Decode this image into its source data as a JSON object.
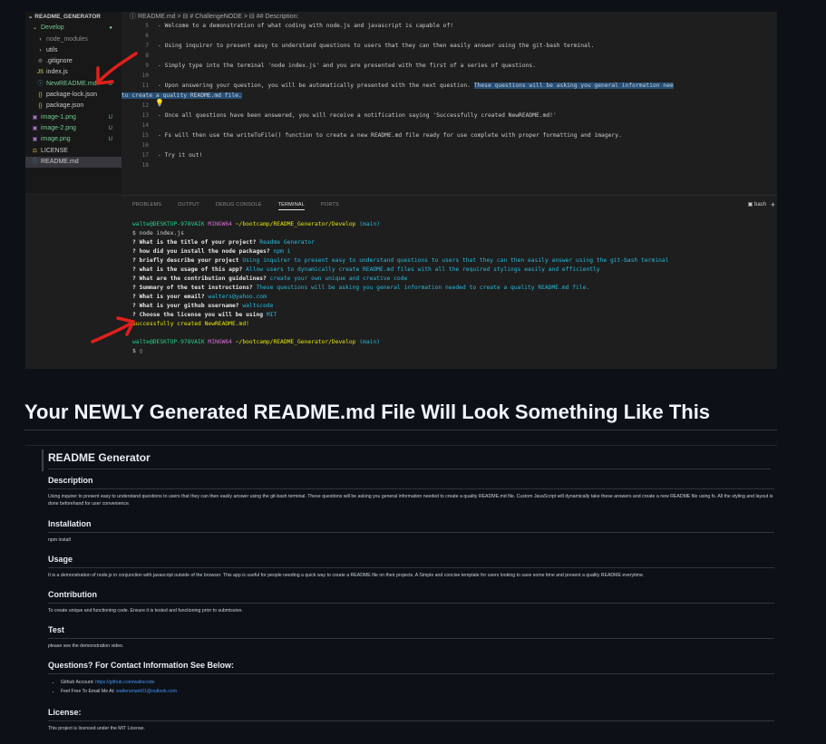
{
  "vscode": {
    "explorer": {
      "root_label": "README_GENERATOR",
      "items": [
        {
          "icon": "chevron-down",
          "label": "Develop",
          "badge": "●",
          "cls": "folder",
          "indent": 6
        },
        {
          "icon": "chevron-right",
          "label": "node_modules",
          "badge": "",
          "cls": "gray",
          "indent": 12
        },
        {
          "icon": "chevron-right",
          "label": "utils",
          "badge": "",
          "cls": "",
          "indent": 12
        },
        {
          "icon": "gear",
          "label": ".gitignore",
          "badge": "",
          "cls": "",
          "indent": 12
        },
        {
          "icon": "js",
          "label": "index.js",
          "badge": "",
          "cls": "",
          "indent": 12
        },
        {
          "icon": "info",
          "label": "NewREADME.md",
          "badge": "U",
          "cls": "mod",
          "indent": 12
        },
        {
          "icon": "braces",
          "label": "package-lock.json",
          "badge": "",
          "cls": "",
          "indent": 12
        },
        {
          "icon": "braces",
          "label": "package.json",
          "badge": "",
          "cls": "",
          "indent": 12
        },
        {
          "icon": "image",
          "label": "image-1.png",
          "badge": "U",
          "cls": "mod",
          "indent": 6
        },
        {
          "icon": "image",
          "label": "image-2.png",
          "badge": "U",
          "cls": "mod",
          "indent": 6
        },
        {
          "icon": "image",
          "label": "image.png",
          "badge": "U",
          "cls": "mod",
          "indent": 6
        },
        {
          "icon": "license",
          "label": "LICENSE",
          "badge": "",
          "cls": "",
          "indent": 6
        },
        {
          "icon": "info",
          "label": "README.md",
          "badge": "",
          "cls": "sel",
          "indent": 6
        }
      ]
    },
    "breadcrumb": "ⓘ README.md > ⊟ # ChallengeNODE > ⊟ ## Description:",
    "editor_lines": [
      {
        "n": "5",
        "text": "- Welcome to a demonstration of what coding with node.js and javascript is capable of!",
        "hl": ""
      },
      {
        "n": "6",
        "text": "",
        "hl": ""
      },
      {
        "n": "7",
        "text": "- Using inquirer to present easy to understand questions to users that they can then easily answer using the git-bash terminal.",
        "hl": ""
      },
      {
        "n": "8",
        "text": "",
        "hl": ""
      },
      {
        "n": "9",
        "text": "- Simply type into the terminal 'node index.js' and you are presented with the first of a series of questions.",
        "hl": ""
      },
      {
        "n": "10",
        "text": "",
        "hl": ""
      },
      {
        "n": "11",
        "text": "- Upon answering your question, you will be automatically presented with the next question. ",
        "hl": "These questions will be asking you general information nee"
      },
      {
        "n": "",
        "text": "",
        "hl": "to create a quality README.md file."
      },
      {
        "n": "12",
        "text": "",
        "hl": ""
      },
      {
        "n": "13",
        "text": "- Once all questions have been answered, you will receive a notification saying 'Successfully created NewREADME.md!'",
        "hl": ""
      },
      {
        "n": "14",
        "text": "",
        "hl": ""
      },
      {
        "n": "15",
        "text": "- Fs will then use the writeToFile() function to create a new README.md file ready for use complete with proper formatting and imagery.",
        "hl": ""
      },
      {
        "n": "16",
        "text": "",
        "hl": ""
      },
      {
        "n": "17",
        "text": "- Try it out!",
        "hl": ""
      },
      {
        "n": "18",
        "text": "",
        "hl": ""
      }
    ],
    "panel_tabs": [
      "PROBLEMS",
      "OUTPUT",
      "DEBUG CONSOLE",
      "TERMINAL",
      "PORTS"
    ],
    "panel_shell": "bash",
    "terminal": {
      "user_host": "walte@DESKTOP-978VAIK",
      "env": "MINGW64",
      "path": "~/bootcamp/README_Generator/Develop",
      "branch": "(main)",
      "command": "$ node index.js",
      "qa": [
        {
          "q": "? What is the title of your project?",
          "a": "Readme Generator"
        },
        {
          "q": "? how did you install the node packages?",
          "a": "npm i"
        },
        {
          "q": "? briefly describe your project",
          "a": "Using inquirer to present easy to understand questions to users that they can then easily answer using the git-bash terminal"
        },
        {
          "q": "? what is the usage of this app?",
          "a": "Allow users to dynamically create README.md files with all the required stylings easily and efficiently"
        },
        {
          "q": "? What are the contribution guidelines?",
          "a": "create your own unique and creative code"
        },
        {
          "q": "? Summary of the test instructions?",
          "a": "These questions will be asking you general information needed to create a quality README.md file."
        },
        {
          "q": "? What is your email?",
          "a": "walters@yahoo.com"
        },
        {
          "q": "? What is your github username?",
          "a": "waltscode"
        },
        {
          "q": "? Choose the license you will be using",
          "a": "MIT"
        }
      ],
      "success": "Successfully created NewREADME.md!",
      "prompt_end": "$ ▯"
    }
  },
  "heading": "Your NEWLY Generated README.md File Will Look Something Like This",
  "readme": {
    "title": "README Generator",
    "description_h": "Description",
    "description_p": "Using inquirer to present easy to understand questions to users that they can then easily answer using the git-bash terminal. These questions will be asking you general information needed to create a quality README.md file. Custom JavaScript will dynamically take these answers and create a new README file using fs. All the styling and layout is done beforehand for user convenience.",
    "installation_h": "Installation",
    "installation_p": "npm install",
    "usage_h": "Usage",
    "usage_p": "It is a demonstration of node.js in conjunction with javascript outside of the browser. This app is useful for people needing a quick way to create a README file on their projects. A Simple and concise template for users looking to save some time and present a quality README everytime.",
    "contribution_h": "Contribution",
    "contribution_p": "To create unique and functioning code. Ensure it is tested and functioning prior to submission.",
    "test_h": "Test",
    "test_p": "please see the demonstration video.",
    "questions_h": "Questions? For Contact Information See Below:",
    "github_label": "Github Account:",
    "github_link": "https://github.com/waltscode",
    "email_label": "Feel Free To Email Me At:",
    "email_link": "waltersmark01@outlook.com",
    "license_h": "License:",
    "license_p": "This project is licensed under the MIT License."
  },
  "colors": {
    "annotation_arrow": "#e0201b",
    "terminal_green": "#23d18b",
    "terminal_magenta": "#d670d6",
    "terminal_yellow": "#e5e510",
    "terminal_cyan": "#29b8db",
    "link_blue": "#4493f8"
  }
}
